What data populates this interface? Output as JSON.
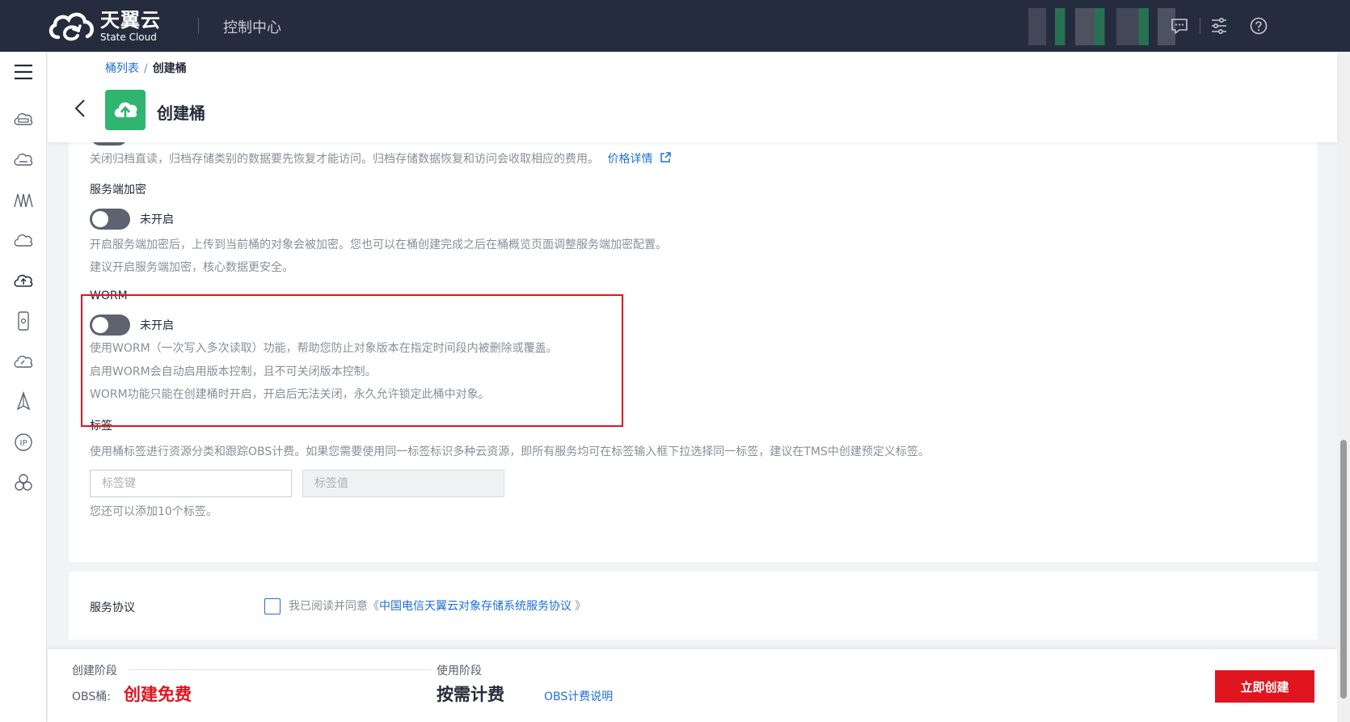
{
  "topbar": {
    "logo_cn": "天翼云",
    "logo_en": "State Cloud",
    "console_title": "控制中心",
    "icons": [
      "message-icon",
      "settings-sliders-icon",
      "help-icon"
    ]
  },
  "leftnav": {
    "icons": [
      "menu-icon",
      "cloud-server-icon",
      "cloud-disk-icon",
      "network-icon",
      "cloud-icon",
      "object-storage-icon",
      "mobile-icon",
      "speed-cloud-icon",
      "compass-icon",
      "ip-icon",
      "cluster-icon"
    ]
  },
  "header": {
    "breadcrumb_parent": "桶列表",
    "breadcrumb_sep": "/",
    "breadcrumb_current": "创建桶",
    "title": "创建桶"
  },
  "archive": {
    "desc": "关闭归档直读，归档存储类别的数据要先恢复才能访问。归档存储数据恢复和访问会收取相应的费用。",
    "price_link": "价格详情"
  },
  "encryption": {
    "label": "服务端加密",
    "toggle_state": "未开启",
    "desc1": "开启服务端加密后，上传到当前桶的对象会被加密。您也可以在桶创建完成之后在桶概览页面调整服务端加密配置。",
    "desc2": "建议开启服务端加密，核心数据更安全。"
  },
  "worm": {
    "label": "WORM",
    "toggle_state": "未开启",
    "desc1": "使用WORM（一次写入多次读取）功能，帮助您防止对象版本在指定时间段内被删除或覆盖。",
    "desc2": "启用WORM会自动启用版本控制，且不可关闭版本控制。",
    "desc3": "WORM功能只能在创建桶时开启，开启后无法关闭，永久允许锁定此桶中对象。"
  },
  "tags": {
    "label": "标签",
    "desc": "使用桶标签进行资源分类和跟踪OBS计费。如果您需要使用同一标签标识多种云资源，即所有服务均可在标签输入框下拉选择同一标签，建议在TMS中创建预定义标签。",
    "key_placeholder": "标签键",
    "value_placeholder": "标签值",
    "remaining": "您还可以添加10个标签。"
  },
  "agreement": {
    "label": "服务协议",
    "text_prefix": "我已阅读并同意《",
    "link": "中国电信天翼云对象存储系统服务协议",
    "text_suffix": "》"
  },
  "footer": {
    "stage1_label": "创建阶段",
    "stage1_item": "OBS桶:",
    "stage1_price": "创建免费",
    "stage2_label": "使用阶段",
    "stage2_price": "按需计费",
    "billing_link": "OBS计费说明",
    "create_button": "立即创建"
  },
  "colors": {
    "topbar": "#252c3d",
    "accent_red": "#e0151f",
    "link_blue": "#1f6fd6",
    "bucket_green": "#2fb56f"
  }
}
